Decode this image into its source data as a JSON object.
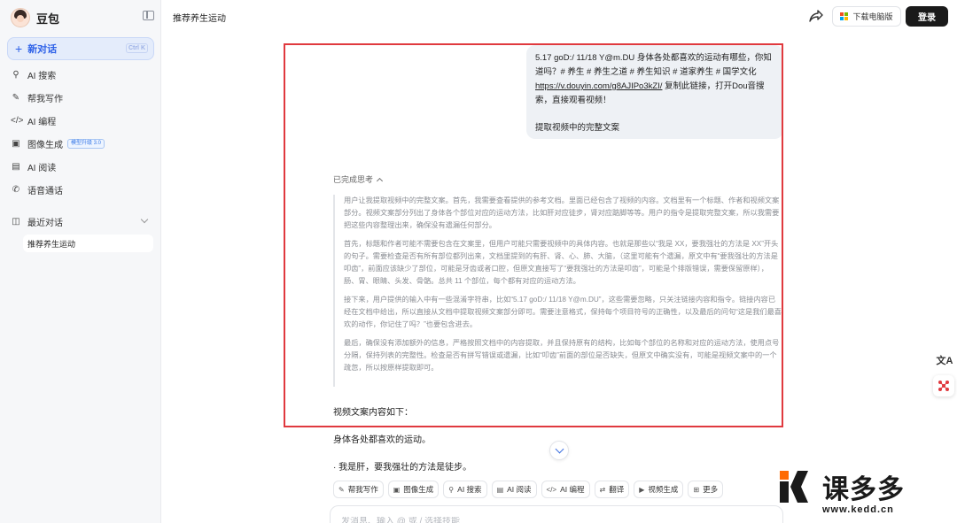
{
  "sidebar": {
    "brand": "豆包",
    "new_chat": {
      "label": "新对话",
      "shortcut": "Ctrl K"
    },
    "nav": [
      {
        "label": "AI 搜索",
        "icon": "search-icon"
      },
      {
        "label": "帮我写作",
        "icon": "pen-icon"
      },
      {
        "label": "AI 编程",
        "icon": "code-icon"
      },
      {
        "label": "图像生成",
        "icon": "image-icon",
        "badge": "模型升级 3.0"
      },
      {
        "label": "AI 阅读",
        "icon": "book-icon"
      },
      {
        "label": "语音通话",
        "icon": "phone-icon"
      }
    ],
    "recent": {
      "label": "最近对话",
      "items": [
        "推荐养生运动"
      ]
    }
  },
  "header": {
    "title": "推荐养生运动",
    "download_label": "下载电脑版",
    "login_label": "登录"
  },
  "chat": {
    "user_message": {
      "line1": "5.17 goD:/ 11/18 Y@m.DU 身体各处都喜欢的运动有哪些，你知道吗？# 养生 # 养生之道 # 养生知识 # 道家养生 # 国学文化",
      "link": "https://v.douyin.com/g8AJIPo3kZI/",
      "line2": " 复制此链接，打开Dou音搜索，直接观看视频！",
      "request": "提取视频中的完整文案"
    },
    "thinking_toggle": "已完成思考",
    "thinking": [
      "用户让我提取视频中的完整文案。首先，我需要查看提供的参考文档。里面已经包含了视频的内容。文档里有一个标题、作者和视频文案部分。视频文案部分列出了身体各个部位对应的运动方法，比如肝对应徒步，肾对应踮脚等等。用户的指令是提取完整文案，所以我需要把这些内容整理出来，确保没有遗漏任何部分。",
      "首先，标题和作者可能不需要包含在文案里，但用户可能只需要视频中的具体内容。也就是那些以“我是 XX，要我强壮的方法是 XX”开头的句子。需要检查是否有所有部位都列出来，文档里提到的有肝、肾、心、肺、大脑，（这里可能有个遗漏，原文中有“要我强壮的方法是叩齿”，前面应该缺少了部位，可能是牙齿或者口腔，但原文直接写了“要我强壮的方法是叩齿”，可能是个排版错误，需要保留原样），肠、胃、眼睛、头发、骨骼。总共 11 个部位，每个都有对应的运动方法。",
      "接下来，用户提供的输入中有一些混淆字符串，比如“5.17 goD:/ 11/18 Y@m.DU”，这些需要忽略，只关注链接内容和指令。链接内容已经在文档中给出，所以直接从文档中提取视频文案部分即可。需要注意格式，保持每个项目符号的正确性，以及最后的问句“这是我们最喜欢的动作，你记住了吗？”也要包含进去。",
      "最后，确保没有添加额外的信息，严格按照文档中的内容提取，并且保持原有的结构，比如每个部位的名称和对应的运动方法，使用点号分隔，保持列表的完整性。检查是否有拼写错误或遗漏，比如“叩齿”前面的部位是否缺失，但原文中确实没有，可能是视频文案中的一个疏忽，所以按原样提取即可。"
    ],
    "answer": {
      "heading": "视频文案内容如下：",
      "line1": "身体各处都喜欢的运动。",
      "line2": "· 我是肝，要我强壮的方法是徒步。"
    },
    "tools": [
      {
        "label": "帮我写作",
        "icon": "pen-icon"
      },
      {
        "label": "图像生成",
        "icon": "image-icon"
      },
      {
        "label": "AI 搜索",
        "icon": "search-icon"
      },
      {
        "label": "AI 阅读",
        "icon": "book-icon"
      },
      {
        "label": "AI 编程",
        "icon": "code-icon"
      },
      {
        "label": "翻译",
        "icon": "translate-icon"
      },
      {
        "label": "视频生成",
        "icon": "video-icon"
      },
      {
        "label": "更多",
        "icon": "grid-icon"
      }
    ],
    "input_placeholder": "发消息、输入 @ 或 / 选择技能"
  },
  "watermark": {
    "brand": "课多多",
    "url": "www.kedd.cn"
  },
  "colors": {
    "accent": "#2f62e8",
    "highlight": "#e0393e",
    "login_bg": "#1a1a1a"
  }
}
